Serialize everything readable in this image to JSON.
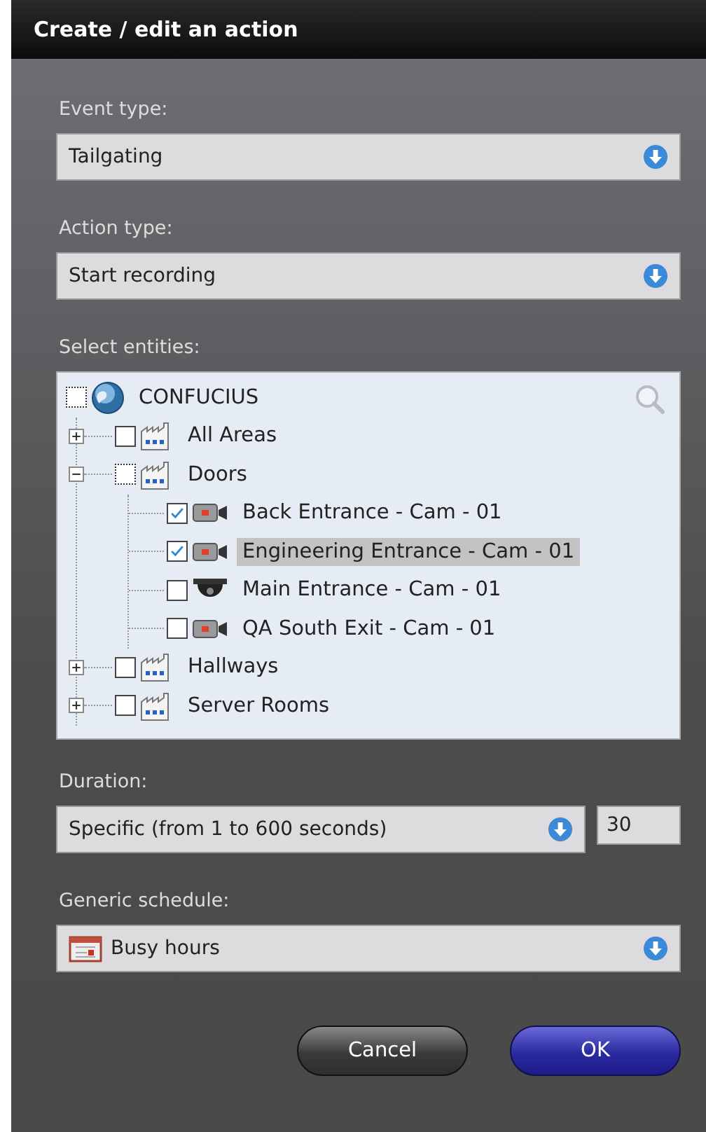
{
  "window": {
    "title": "Create / edit an action"
  },
  "event_type": {
    "label": "Event type:",
    "value": "Tailgating"
  },
  "action_type": {
    "label": "Action type:",
    "value": "Start recording"
  },
  "entities": {
    "label": "Select entities:",
    "tree": [
      {
        "label": "CONFUCIUS",
        "kind": "server",
        "checked": false,
        "partial": true,
        "selected": false,
        "children": [
          {
            "label": "All Areas",
            "kind": "area",
            "checked": false,
            "partial": false,
            "selected": false,
            "expanded": false
          },
          {
            "label": "Doors",
            "kind": "area",
            "checked": false,
            "partial": true,
            "selected": false,
            "expanded": true,
            "children": [
              {
                "label": "Back Entrance - Cam - 01",
                "kind": "camera",
                "checked": true,
                "partial": false,
                "selected": false
              },
              {
                "label": "Engineering Entrance - Cam - 01",
                "kind": "camera",
                "checked": true,
                "partial": false,
                "selected": true
              },
              {
                "label": "Main Entrance - Cam - 01",
                "kind": "dome-camera",
                "checked": false,
                "partial": false,
                "selected": false
              },
              {
                "label": "QA South Exit - Cam - 01",
                "kind": "camera",
                "checked": false,
                "partial": false,
                "selected": false
              }
            ]
          },
          {
            "label": "Hallways",
            "kind": "area",
            "checked": false,
            "partial": false,
            "selected": false,
            "expanded": false
          },
          {
            "label": "Server Rooms",
            "kind": "area",
            "checked": false,
            "partial": false,
            "selected": false,
            "expanded": false
          }
        ]
      }
    ]
  },
  "duration": {
    "label": "Duration:",
    "value": "Specific (from 1 to 600 seconds)",
    "seconds": "30"
  },
  "schedule": {
    "label": "Generic schedule:",
    "value": "Busy hours"
  },
  "buttons": [
    {
      "label": "Cancel",
      "kind": "secondary"
    },
    {
      "label": "OK",
      "kind": "primary"
    }
  ]
}
